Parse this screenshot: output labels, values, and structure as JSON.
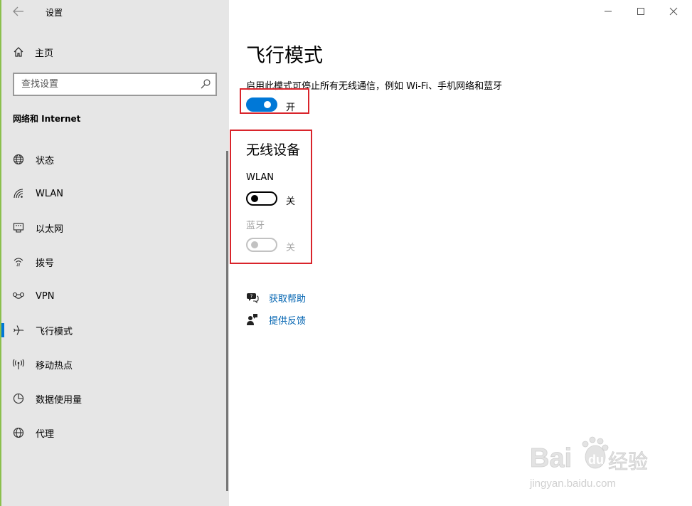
{
  "window": {
    "title": "设置",
    "controls": [
      "minimize-icon",
      "maximize-icon",
      "close-icon"
    ]
  },
  "sidebar": {
    "home_label": "主页",
    "search_placeholder": "查找设置",
    "section_title": "网络和 Internet",
    "items": [
      {
        "label": "状态",
        "icon": "globe-status-icon"
      },
      {
        "label": "WLAN",
        "icon": "wifi-icon"
      },
      {
        "label": "以太网",
        "icon": "ethernet-icon"
      },
      {
        "label": "拨号",
        "icon": "dialup-icon"
      },
      {
        "label": "VPN",
        "icon": "vpn-icon"
      },
      {
        "label": "飞行模式",
        "icon": "airplane-icon",
        "selected": true
      },
      {
        "label": "移动热点",
        "icon": "hotspot-icon"
      },
      {
        "label": "数据使用量",
        "icon": "data-usage-icon"
      },
      {
        "label": "代理",
        "icon": "globe-proxy-icon"
      }
    ]
  },
  "main": {
    "title": "飞行模式",
    "description": "启用此模式可停止所有无线通信，例如 Wi-Fi、手机网络和蓝牙",
    "airplane_toggle": {
      "state": "on",
      "label": "开"
    },
    "wireless_title": "无线设备",
    "wlan": {
      "label": "WLAN",
      "state": "off",
      "state_label": "关"
    },
    "bluetooth": {
      "label": "蓝牙",
      "state": "off",
      "disabled": true,
      "state_label": "关"
    },
    "links": [
      {
        "label": "获取帮助",
        "icon": "help-chat-icon"
      },
      {
        "label": "提供反馈",
        "icon": "feedback-icon"
      }
    ]
  },
  "watermark": {
    "text": "Bai du 经验",
    "subtext": "jingyan.baidu.com"
  },
  "colors": {
    "accent": "#0078d7",
    "highlight_box": "#d9242b",
    "link": "#0063b1",
    "sidebar_bg": "#e6e6e6"
  }
}
